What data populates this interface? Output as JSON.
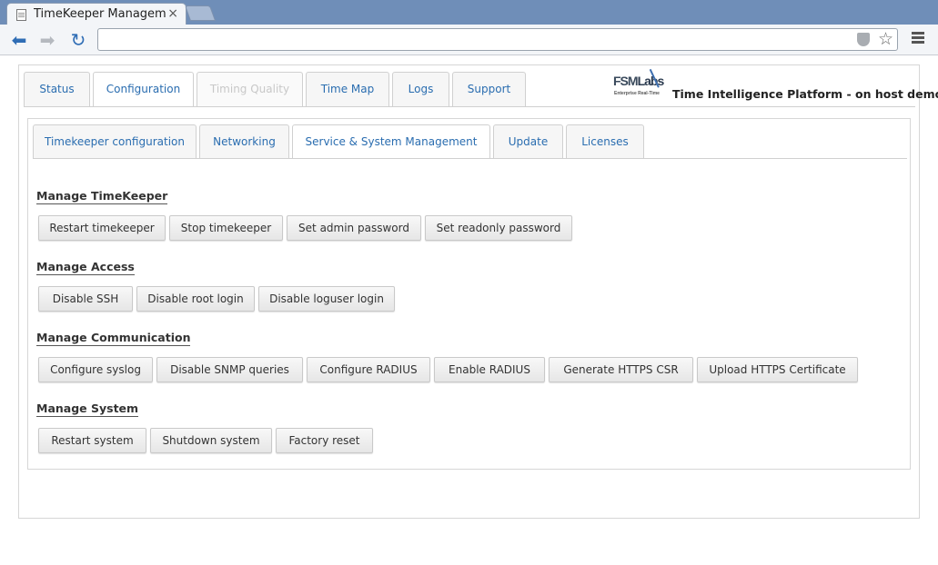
{
  "browser": {
    "tab_title": "TimeKeeper Manageme",
    "tab_close": "×",
    "url": ""
  },
  "main_tabs": [
    {
      "label": "Status"
    },
    {
      "label": "Configuration"
    },
    {
      "label": "Timing Quality"
    },
    {
      "label": "Time Map"
    },
    {
      "label": "Logs"
    },
    {
      "label": "Support"
    }
  ],
  "brand": {
    "logo_fsm": "FSM",
    "logo_labs": "Labs",
    "logo_tagline": "Enterprise Real-Time",
    "platform_title": "Time Intelligence Platform - on host demo"
  },
  "sub_tabs": [
    {
      "label": "Timekeeper configuration"
    },
    {
      "label": "Networking"
    },
    {
      "label": "Service & System Management"
    },
    {
      "label": "Update"
    },
    {
      "label": "Licenses"
    }
  ],
  "sections": [
    {
      "title": "Manage TimeKeeper",
      "buttons": [
        "Restart timekeeper",
        "Stop timekeeper",
        "Set admin password",
        "Set readonly password"
      ]
    },
    {
      "title": "Manage Access",
      "buttons": [
        "Disable SSH",
        "Disable root login",
        "Disable loguser login"
      ]
    },
    {
      "title": "Manage Communication",
      "buttons": [
        "Configure syslog",
        "Disable SNMP queries",
        "Configure RADIUS",
        "Enable RADIUS",
        "Generate HTTPS CSR",
        "Upload HTTPS Certificate"
      ]
    },
    {
      "title": "Manage System",
      "buttons": [
        "Restart system",
        "Shutdown system",
        "Factory reset"
      ]
    }
  ],
  "colors": {
    "link_blue": "#2a6db0",
    "chrome_blue": "#6f8eb8",
    "disabled_tab": "#c8c8c8"
  }
}
